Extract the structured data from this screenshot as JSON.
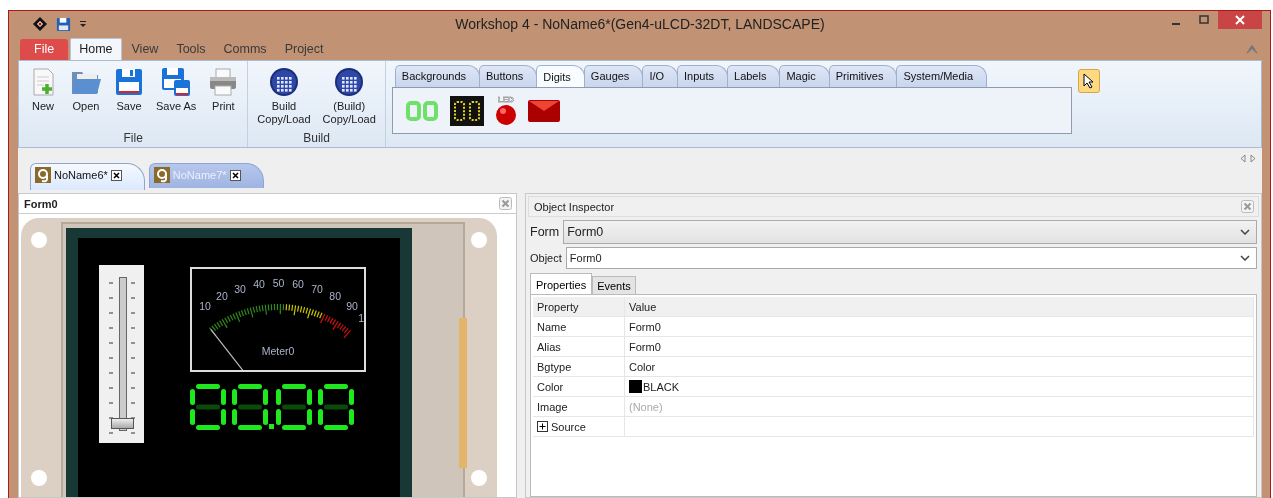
{
  "window": {
    "title": "Workshop 4 - NoName6*(Gen4-uLCD-32DT, LANDSCAPE)"
  },
  "ribbon_tabs": [
    {
      "label": "File",
      "kind": "file",
      "selected": false
    },
    {
      "label": "Home",
      "kind": "tab",
      "selected": true
    },
    {
      "label": "View",
      "kind": "tab",
      "selected": false
    },
    {
      "label": "Tools",
      "kind": "tab",
      "selected": false
    },
    {
      "label": "Comms",
      "kind": "tab",
      "selected": false
    },
    {
      "label": "Project",
      "kind": "tab",
      "selected": false
    }
  ],
  "ribbon_groups": [
    {
      "label": "File",
      "buttons": [
        {
          "lines": [
            "New"
          ],
          "kind": "new"
        },
        {
          "lines": [
            "Open"
          ],
          "kind": "open"
        },
        {
          "lines": [
            "Save"
          ],
          "kind": "save"
        },
        {
          "lines": [
            "Save As"
          ],
          "kind": "saveas"
        },
        {
          "lines": [
            "Print"
          ],
          "kind": "print"
        }
      ]
    },
    {
      "label": "Build",
      "buttons": [
        {
          "lines": [
            "Build",
            "Copy/Load"
          ],
          "kind": "build"
        },
        {
          "lines": [
            "(Build)",
            "Copy/Load"
          ],
          "kind": "build"
        }
      ]
    }
  ],
  "palette": {
    "tabs": [
      {
        "label": "Backgrounds",
        "selected": false
      },
      {
        "label": "Buttons",
        "selected": false
      },
      {
        "label": "Digits",
        "selected": true
      },
      {
        "label": "Gauges",
        "selected": false
      },
      {
        "label": "I/O",
        "selected": false
      },
      {
        "label": "Inputs",
        "selected": false
      },
      {
        "label": "Labels",
        "selected": false
      },
      {
        "label": "Magic",
        "selected": false
      },
      {
        "label": "Primitives",
        "selected": false
      },
      {
        "label": "System/Media",
        "selected": false
      }
    ],
    "items": [
      {
        "kind": "digits"
      },
      {
        "kind": "led-digits"
      },
      {
        "kind": "led",
        "label": "LED"
      },
      {
        "kind": "indicator"
      }
    ]
  },
  "documents": [
    {
      "title": "NoName6*",
      "selected": true
    },
    {
      "title": "NoName7*",
      "selected": false
    }
  ],
  "form_panel": {
    "title": "Form0",
    "slider": {
      "level": 0
    },
    "meter": {
      "scale": [
        "10",
        "20",
        "30",
        "40",
        "50",
        "60",
        "70",
        "80",
        "90",
        "1"
      ],
      "caption": "Meter0"
    }
  },
  "inspector": {
    "title": "Object Inspector",
    "form": {
      "label": "Form",
      "value": "Form0"
    },
    "object": {
      "label": "Object",
      "value": "Form0"
    },
    "tabs": [
      {
        "label": "Properties",
        "selected": true
      },
      {
        "label": "Events",
        "selected": false
      }
    ],
    "columns": [
      "Property",
      "Value"
    ],
    "rows": [
      {
        "property": "Name",
        "value": "Form0",
        "kind": "text"
      },
      {
        "property": "Alias",
        "value": "Form0",
        "kind": "text"
      },
      {
        "property": "Bgtype",
        "value": "Color",
        "kind": "text"
      },
      {
        "property": "Color",
        "value": "BLACK",
        "kind": "color",
        "color": "#000000"
      },
      {
        "property": "Image",
        "value": "(None)",
        "kind": "none"
      },
      {
        "property": "Source",
        "kind": "group"
      }
    ]
  }
}
